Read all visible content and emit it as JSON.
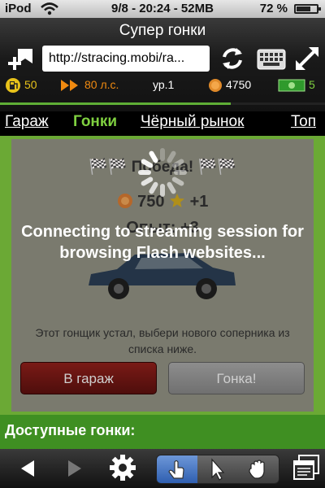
{
  "status_bar": {
    "carrier": "iPod",
    "clock": "9/8 - 20:24 - 52MB",
    "battery_percent": "72 %",
    "battery_level": 0.72
  },
  "browser": {
    "title": "Супер гонки",
    "url": "http://stracing.mobi/ra...",
    "icons": [
      "bookmark-add-icon",
      "reload-icon",
      "keyboard-icon",
      "fullscreen-icon"
    ]
  },
  "game_stats": {
    "fuel": "50",
    "horsepower": "80 л.с.",
    "level": "ур.1",
    "coins": "4750",
    "cash": "5",
    "level_progress": 0.71
  },
  "nav": {
    "garage": "Гараж",
    "races": "Гонки",
    "black_market": "Чёрный рынок",
    "top": "Топ"
  },
  "result": {
    "title": "🏁🏁 Победа! 🏁🏁",
    "reward_coins": "750",
    "reward_stars": "+1",
    "experience": "Опыт: +3",
    "message": "Этот гонщик устал, выбери нового соперника из списка ниже.",
    "btn_garage": "В гараж",
    "btn_race": "Гонка!"
  },
  "available_races": "Доступные гонки:",
  "overlay": {
    "message": "Connecting to streaming session for browsing Flash websites..."
  },
  "colors": {
    "accent_green": "#5fae36",
    "nav_active": "#7fd040",
    "garage_red": "#7a1a16"
  }
}
